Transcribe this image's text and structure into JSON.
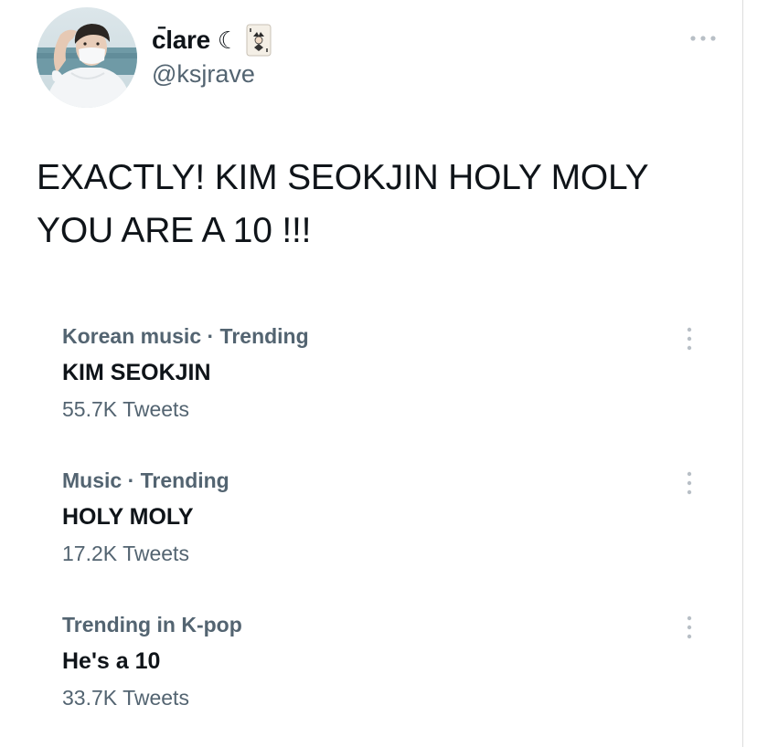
{
  "user": {
    "display_name": "c̄lare",
    "moon_symbol": "☾",
    "handle": "@ksjrave",
    "avatar_icon": "profile-photo"
  },
  "tweet": {
    "text": "EXACTLY! KIM SEOKJIN HOLY MOLY YOU ARE A 10 !!!"
  },
  "trends": [
    {
      "meta": "Korean music · Trending",
      "title": "KIM SEOKJIN",
      "count": "55.7K Tweets"
    },
    {
      "meta": "Music · Trending",
      "title": "HOLY MOLY",
      "count": "17.2K Tweets"
    },
    {
      "meta": "Trending in K-pop",
      "title": "He's a 10",
      "count": "33.7K Tweets"
    }
  ],
  "colors": {
    "text": "#0f1419",
    "secondary": "#536471",
    "icon_gray": "#b8bfc6"
  }
}
